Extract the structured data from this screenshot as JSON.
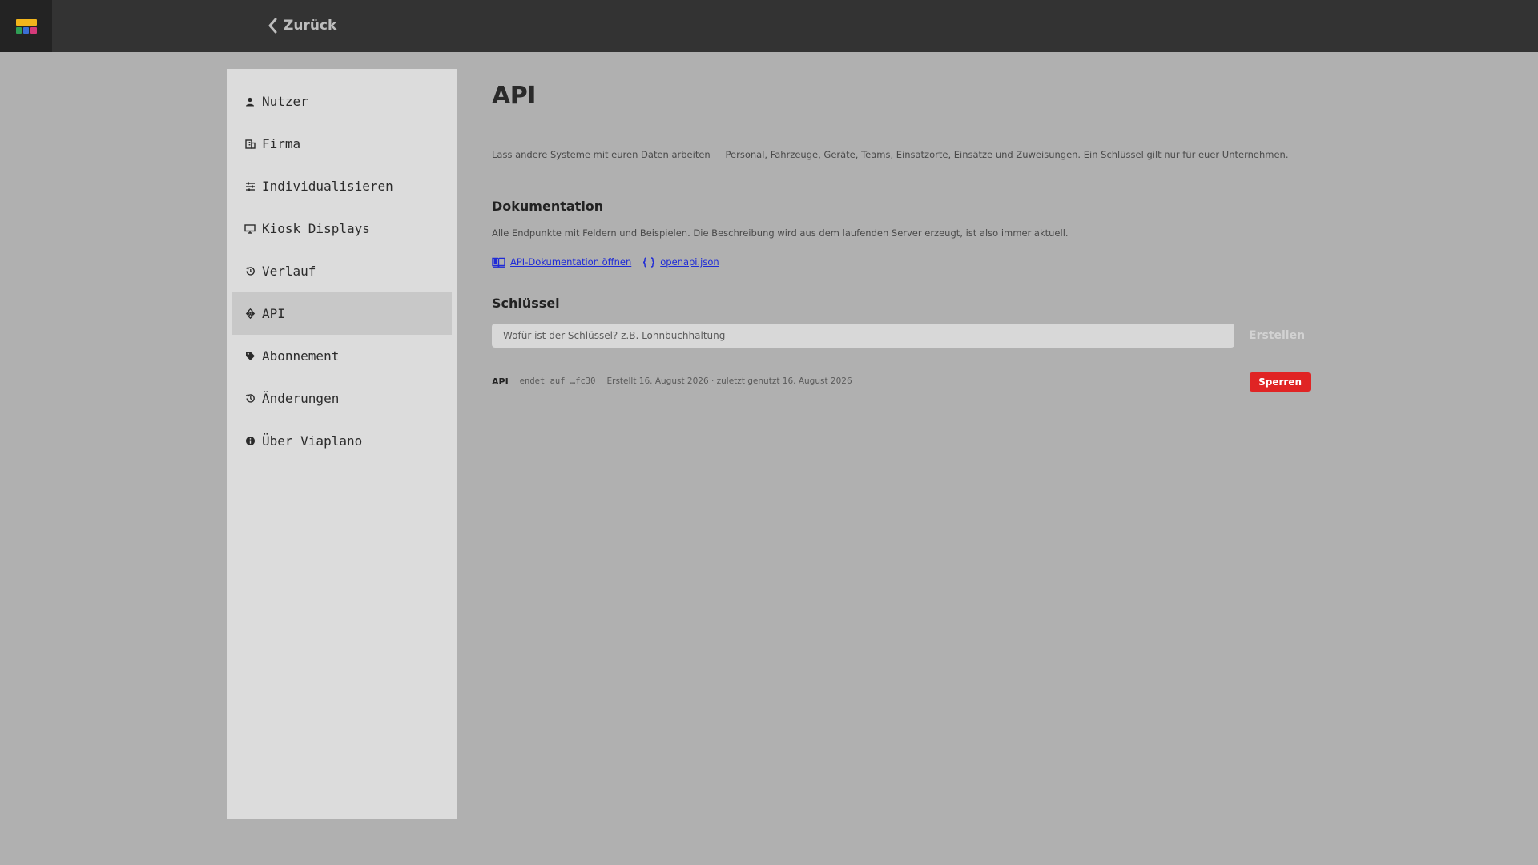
{
  "topbar": {
    "back_label": "Zurück"
  },
  "sidebar": {
    "items": [
      {
        "label": "Nutzer",
        "icon": "person-icon",
        "active": false
      },
      {
        "label": "Firma",
        "icon": "building-icon",
        "active": false
      },
      {
        "label": "Individualisieren",
        "icon": "sliders-icon",
        "active": false
      },
      {
        "label": "Kiosk Displays",
        "icon": "monitor-icon",
        "active": false
      },
      {
        "label": "Verlauf",
        "icon": "history-icon",
        "active": false
      },
      {
        "label": "API",
        "icon": "api-icon",
        "active": true
      },
      {
        "label": "Abonnement",
        "icon": "tag-icon",
        "active": false
      },
      {
        "label": "Änderungen",
        "icon": "changes-icon",
        "active": false
      },
      {
        "label": "Über Viaplano",
        "icon": "info-icon",
        "active": false
      }
    ]
  },
  "main": {
    "title": "API",
    "intro": "Lass andere Systeme mit euren Daten arbeiten — Personal, Fahrzeuge, Geräte, Teams, Einsatzorte, Einsätze und Zuweisungen. Ein Schlüssel gilt nur für euer Unternehmen.",
    "docs": {
      "title": "Dokumentation",
      "text": "Alle Endpunkte mit Feldern und Beispielen. Die Beschreibung wird aus dem laufenden Server erzeugt, ist also immer aktuell.",
      "link_docs": "API-Dokumentation öffnen",
      "link_json": "openapi.json"
    },
    "keys": {
      "title": "Schlüssel",
      "input_placeholder": "Wofür ist der Schlüssel? z.B. Lohnbuchhaltung",
      "input_value": "",
      "create_label": "Erstellen",
      "rows": [
        {
          "name": "API",
          "suffix": "endet auf …fc30",
          "meta": "Erstellt 16. August 2026 · zuletzt genutzt 16. August 2026",
          "revoke_label": "Sperren"
        }
      ]
    }
  },
  "colors": {
    "topbar": "#333333",
    "page_bg": "#b0b0b0",
    "sidebar_bg": "#dcdcdc",
    "active_item": "#c8c8c8",
    "link": "#1f2bd6",
    "danger": "#e02424"
  }
}
